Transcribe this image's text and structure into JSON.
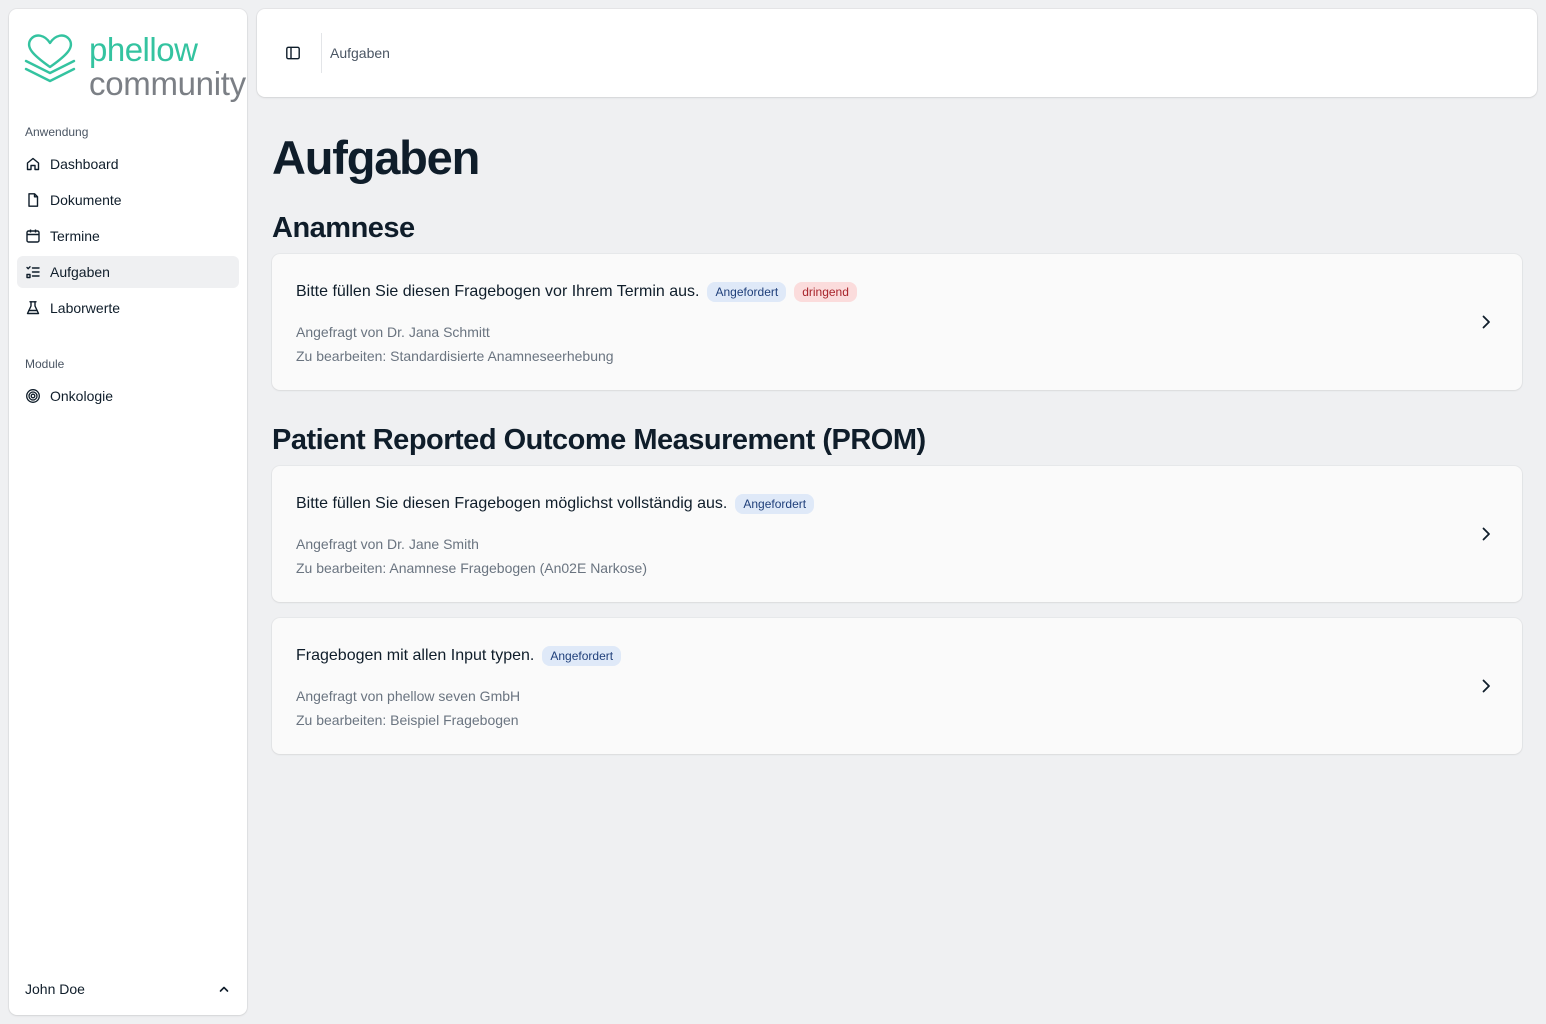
{
  "brand": {
    "line1": "phellow",
    "line2": "community",
    "colors": {
      "primary": "#34c3a0",
      "secondary": "#7b7f85"
    }
  },
  "sidebar": {
    "group_app": "Anwendung",
    "items": [
      {
        "label": "Dashboard",
        "icon": "home-icon"
      },
      {
        "label": "Dokumente",
        "icon": "file-icon"
      },
      {
        "label": "Termine",
        "icon": "calendar-icon"
      },
      {
        "label": "Aufgaben",
        "icon": "list-check-icon",
        "active": true
      },
      {
        "label": "Laborwerte",
        "icon": "flask-icon"
      }
    ],
    "group_modules": "Module",
    "modules": [
      {
        "label": "Onkologie",
        "icon": "spiral-icon"
      }
    ],
    "user": "John Doe"
  },
  "topbar": {
    "breadcrumb": "Aufgaben"
  },
  "page": {
    "title": "Aufgaben"
  },
  "sections": [
    {
      "title": "Anamnese",
      "tasks": [
        {
          "title": "Bitte füllen Sie diesen Fragebogen vor Ihrem Termin aus.",
          "badges": [
            "Angefordert",
            "dringend"
          ],
          "requested_by": "Angefragt von Dr. Jana Schmitt",
          "to_edit": "Zu bearbeiten: Standardisierte Anamneseerhebung"
        }
      ]
    },
    {
      "title": "Patient Reported Outcome Measurement (PROM)",
      "tasks": [
        {
          "title": "Bitte füllen Sie diesen Fragebogen möglichst vollständig aus.",
          "badges": [
            "Angefordert"
          ],
          "requested_by": "Angefragt von Dr. Jane Smith",
          "to_edit": "Zu bearbeiten: Anamnese Fragebogen (An02E Narkose)"
        },
        {
          "title": "Fragebogen mit allen Input typen.",
          "badges": [
            "Angefordert"
          ],
          "requested_by": "Angefragt von phellow seven GmbH",
          "to_edit": "Zu bearbeiten: Beispiel Fragebogen"
        }
      ]
    }
  ]
}
